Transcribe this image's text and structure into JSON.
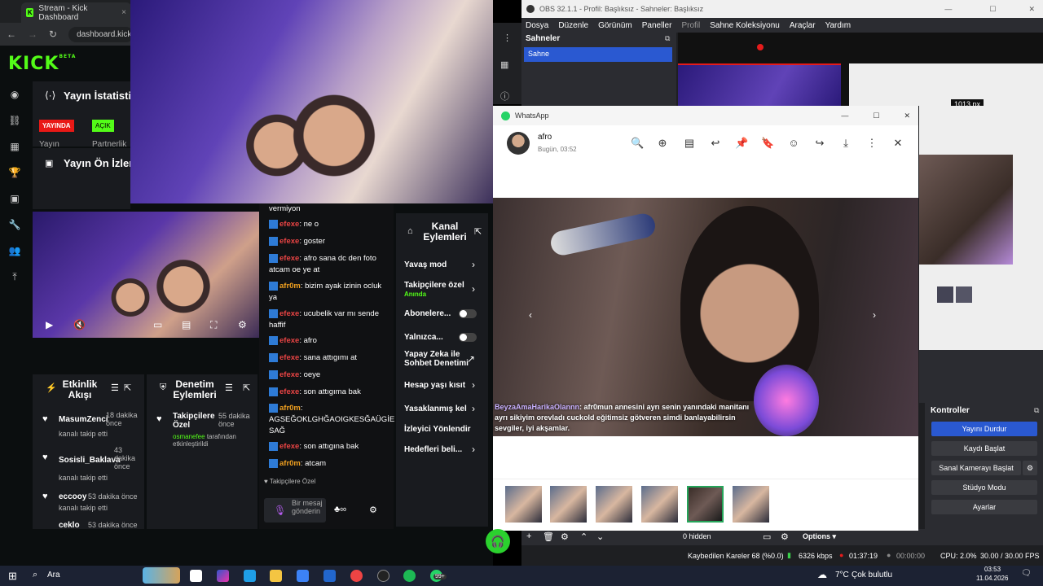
{
  "browser": {
    "tab_title": "Stream - Kick Dashboard",
    "url": "dashboard.kick.com",
    "kick_logo": "KICK",
    "kick_logo_sup": "BETA"
  },
  "dashboard": {
    "stats_title": "Yayın İstatistikleri",
    "live_badge": "YAYINDA",
    "open_badge": "AÇIK",
    "label_stream": "Yayın",
    "label_partner": "Partnerlik",
    "preview_title": "Yayın Ön İzleme"
  },
  "activity": {
    "title": "Etkinlik Akışı",
    "items": [
      {
        "name": "MasumZenci",
        "time": "18 dakika önce",
        "action": "kanalı takip etti"
      },
      {
        "name": "Sosisli_Baklava",
        "time": "43 dakika önce",
        "action": "kanalı takip etti"
      },
      {
        "name": "eccooy",
        "time": "53 dakika önce",
        "action": "kanalı takip etti"
      },
      {
        "name": "ceklo",
        "time": "53 dakika önce",
        "action": ""
      }
    ]
  },
  "moderation": {
    "title": "Denetim Eylemleri",
    "item_title": "Takipçilere Özel",
    "item_time": "55 dakika önce",
    "item_user": "osmanefee",
    "item_action": "tarafından etkinleştirildi"
  },
  "chat": {
    "messages": [
      {
        "user": "",
        "text": "vermiyon"
      },
      {
        "user": "efexe",
        "text": ": ne o"
      },
      {
        "user": "efexe",
        "text": ": goster"
      },
      {
        "user": "efexe",
        "text": ": afro sana dc den foto atcam oe ye at"
      },
      {
        "user": "afr0m",
        "text": ": bizim ayak izinin ocluk ya"
      },
      {
        "user": "efexe",
        "text": ": ucubelik var mı sende haffif"
      },
      {
        "user": "efexe",
        "text": ": afro"
      },
      {
        "user": "efexe",
        "text": ": sana attıgımı at"
      },
      {
        "user": "efexe",
        "text": ": oeye"
      },
      {
        "user": "efexe",
        "text": ": son attıgıma bak"
      },
      {
        "user": "afr0m",
        "text": ": AGSEĞOKLGHĞAOIGKESĞAÜGİE SAĞ"
      },
      {
        "user": "efexe",
        "text": ": son attıgına bak"
      },
      {
        "user": "afr0m",
        "text": ": atcam"
      }
    ],
    "followers_only": "Takipçilere Özel",
    "input_placeholder": "Bir mesaj gönderin"
  },
  "channel_actions": {
    "title": "Kanal Eylemleri",
    "slow_mode": "Yavaş mod",
    "followers_only": "Takipçilere özel",
    "followers_only_sub": "Anında",
    "subscribers": "Abonelere...",
    "only": "Yalnızca...",
    "ai_mod": "Yapay Zeka ile Sohbet Denetimi",
    "account_age": "Hesap yaşı kısıt",
    "banned_words": "Yasaklanmış kel",
    "viewer_redirect": "İzleyici Yönlendir",
    "goals": "Hedefleri beli..."
  },
  "obs": {
    "title": "OBS 32.1.1 - Profil: Başlıksız - Sahneler: Başlıksız",
    "menu": [
      "Dosya",
      "Düzenle",
      "Görünüm",
      "Paneller",
      "Profil",
      "Sahne Koleksiyonu",
      "Araçlar",
      "Yardım"
    ],
    "scenes_header": "Sahneler",
    "scene": "Sahne",
    "px_label": "1013 px",
    "controls_title": "Kontroller",
    "btn_stop": "Yayını Durdur",
    "btn_record": "Kaydı Başlat",
    "btn_vcam": "Sanal Kamerayı Başlat",
    "btn_studio": "Stüdyo Modu",
    "btn_settings": "Ayarlar",
    "hidden": "0 hidden",
    "options": "Options",
    "status_dropped": "Kaybedilen Kareler 68 (%0.0)",
    "status_kbps": "6326 kbps",
    "status_time": "01:37:19",
    "status_rec": "00:00:00",
    "status_cpu": "CPU: 2.0%",
    "status_fps": "30.00 / 30.00 FPS"
  },
  "whatsapp": {
    "app_title": "WhatsApp",
    "contact": "afro",
    "time": "Bugün, 03:52",
    "caption_user": "BeyzaAmaHarikaOlannn",
    "caption_text": ": afr0mun annesini ayrı senin yanındaki manitanı ayrı sikiyim orevladı cuckold eğitimsiz götveren simdi banlayabilirsin sevgiler, iyi akşamlar."
  },
  "taskbar": {
    "search": "Ara",
    "weather": "7°C",
    "weather_desc": "Çok bulutlu",
    "clock_time": "03:53",
    "clock_date": "11.04.2026",
    "whatsapp_badge": "99+"
  },
  "colors": {
    "kick_green": "#53fc18",
    "live_red": "#e91916",
    "obs_blue": "#2a59d1"
  }
}
